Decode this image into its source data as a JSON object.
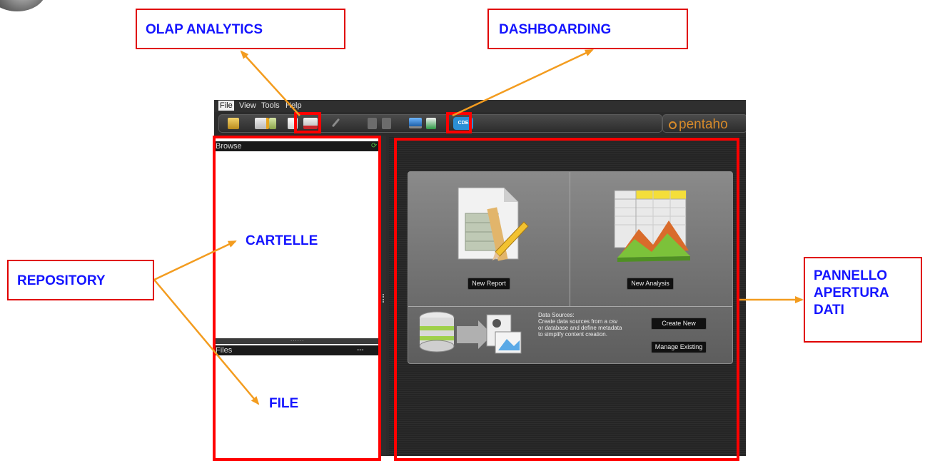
{
  "annotations": {
    "olap": "OLAP ANALYTICS",
    "dashboarding": "DASHBOARDING",
    "repository": "REPOSITORY",
    "pannello_line1": "PANNELLO",
    "pannello_line2": "APERTURA",
    "pannello_line3": "DATI",
    "cartelle": "CARTELLE",
    "file": "FILE"
  },
  "menu": {
    "file": "File",
    "view": "View",
    "tools": "Tools",
    "help": "Help"
  },
  "toolbar": {
    "cde": "CDE"
  },
  "brand": "pentaho",
  "panels": {
    "browse_title": "Browse",
    "files_title": "Files"
  },
  "launch": {
    "new_report": "New Report",
    "new_analysis": "New Analysis",
    "datasource_title": "Data Sources:",
    "datasource_line1": "Create data sources from a csv",
    "datasource_line2": "or database and define metadata",
    "datasource_line3": "to simplify content creation.",
    "create_new": "Create New",
    "manage_existing": "Manage Existing"
  },
  "colors": {
    "callout_border": "#e00000",
    "callout_text": "#1515ff",
    "arrow": "#f39c1f",
    "highlight": "#ff0000",
    "brand": "#d68a2a"
  }
}
